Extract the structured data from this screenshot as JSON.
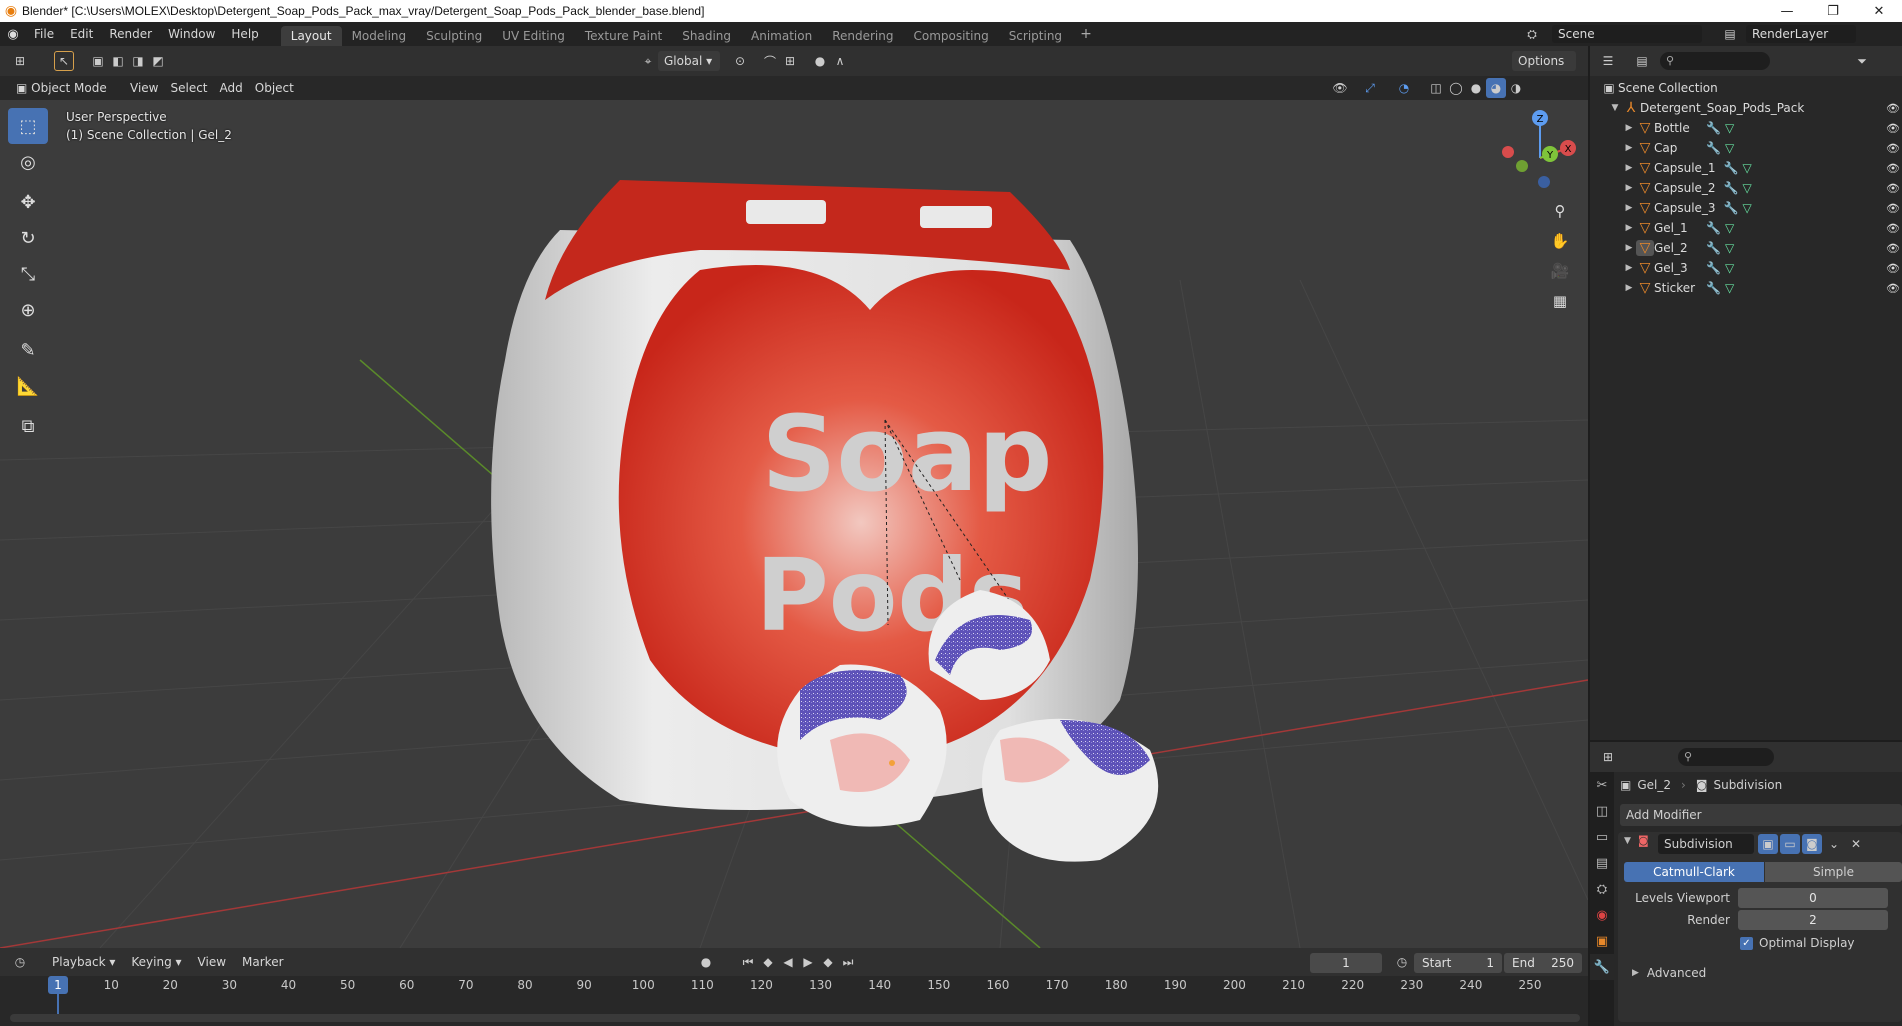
{
  "window": {
    "title": "Blender* [C:\\Users\\MOLEX\\Desktop\\Detergent_Soap_Pods_Pack_max_vray/Detergent_Soap_Pods_Pack_blender_base.blend]",
    "minimize": "—",
    "restore": "❐",
    "close": "✕"
  },
  "menu": {
    "items": [
      "File",
      "Edit",
      "Render",
      "Window",
      "Help"
    ]
  },
  "workspaces": {
    "tabs": [
      "Layout",
      "Modeling",
      "Sculpting",
      "UV Editing",
      "Texture Paint",
      "Shading",
      "Animation",
      "Rendering",
      "Compositing",
      "Scripting"
    ],
    "active": "Layout",
    "add": "+"
  },
  "scene": {
    "name": "Scene",
    "render_layer": "RenderLayer"
  },
  "viewport_tools": {
    "transform_orientation": "Global",
    "options": "Options"
  },
  "viewport_header": {
    "mode": "Object Mode",
    "menus": [
      "View",
      "Select",
      "Add",
      "Object"
    ]
  },
  "viewport": {
    "perspective": "User Perspective",
    "collection_info": "(1) Scene Collection | Gel_2",
    "sticker_text_1": "Soap",
    "sticker_text_2": "Pods",
    "gizmo": {
      "z": "Z",
      "y": "Y",
      "x": "X"
    }
  },
  "outliner": {
    "root": "Scene Collection",
    "collection": "Detergent_Soap_Pods_Pack",
    "objects": [
      {
        "name": "Bottle"
      },
      {
        "name": "Cap"
      },
      {
        "name": "Capsule_1"
      },
      {
        "name": "Capsule_2"
      },
      {
        "name": "Capsule_3"
      },
      {
        "name": "Gel_1"
      },
      {
        "name": "Gel_2"
      },
      {
        "name": "Gel_3"
      },
      {
        "name": "Sticker"
      }
    ]
  },
  "properties": {
    "object_name": "Gel_2",
    "modifier_breadcrumb": "Subdivision",
    "add_modifier": "Add Modifier",
    "modifier_name": "Subdivision",
    "catmull_clark": "Catmull-Clark",
    "simple": "Simple",
    "levels_viewport_label": "Levels Viewport",
    "levels_viewport": "0",
    "render_label": "Render",
    "render_value": "2",
    "optimal_display": "Optimal Display",
    "advanced": "Advanced"
  },
  "timeline": {
    "menus": [
      "Playback",
      "Keying",
      "View",
      "Marker"
    ],
    "current_frame": "1",
    "start_label": "Start",
    "start": "1",
    "end_label": "End",
    "end": "250",
    "ticks": [
      "1",
      "10",
      "20",
      "30",
      "40",
      "50",
      "60",
      "70",
      "80",
      "90",
      "100",
      "110",
      "120",
      "130",
      "140",
      "150",
      "160",
      "170",
      "180",
      "190",
      "200",
      "210",
      "220",
      "230",
      "240",
      "250"
    ]
  },
  "colors": {
    "accent": "#4772b3",
    "object_icon": "#e8882a",
    "mesh_icon": "#66e0a0",
    "modifier_icon": "#7aa4e6",
    "bottle_red": "#d8301f"
  }
}
